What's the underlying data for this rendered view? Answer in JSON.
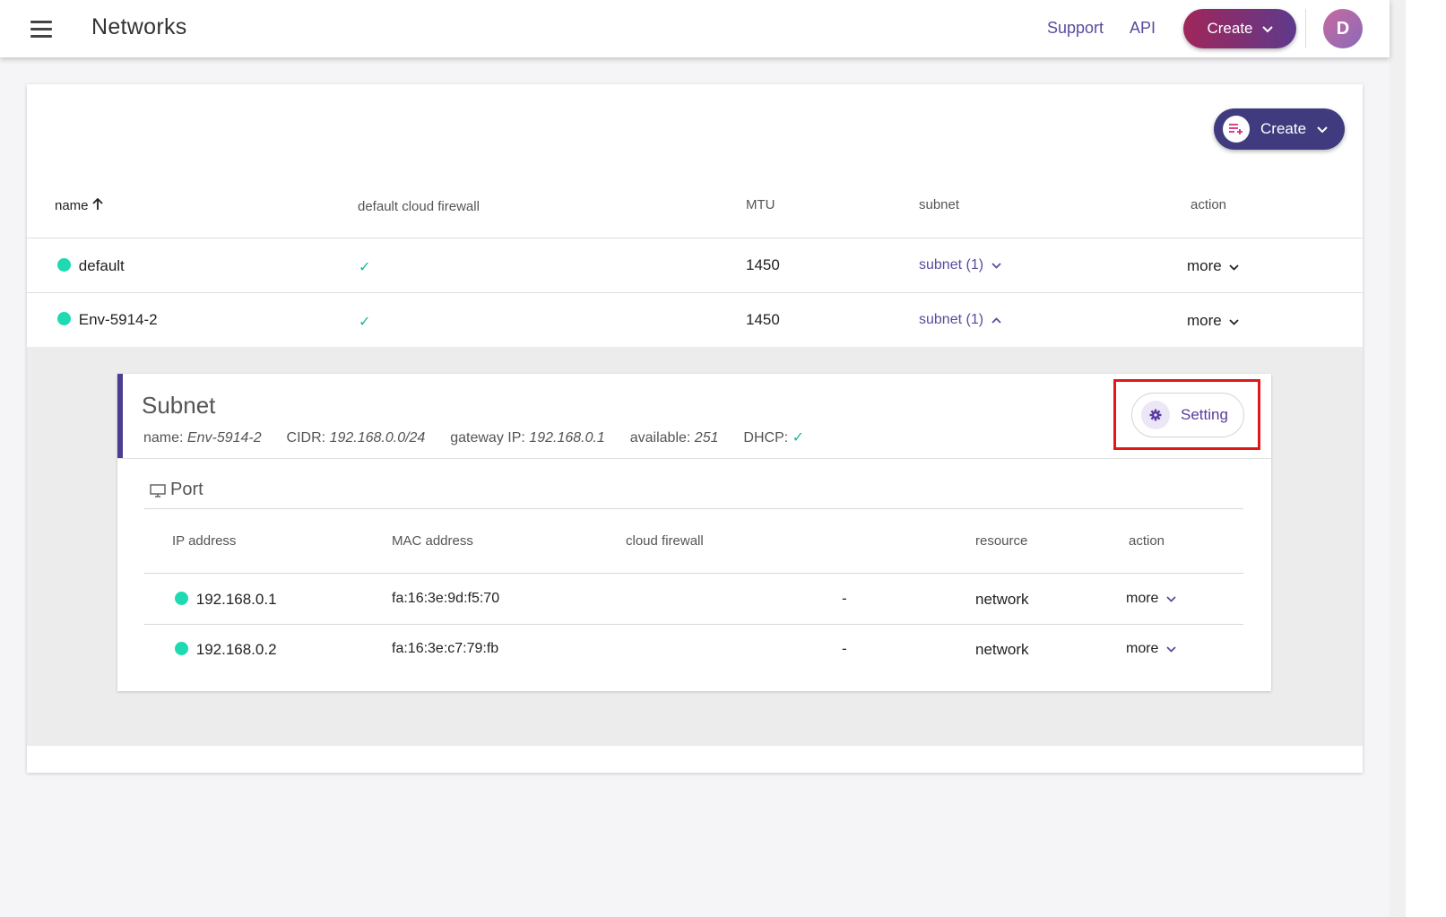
{
  "header": {
    "title": "Networks",
    "links": [
      "Support",
      "API"
    ],
    "create_label": "Create",
    "avatar_initial": "D"
  },
  "toolbar": {
    "create_label": "Create"
  },
  "table": {
    "columns": [
      "name",
      "default cloud firewall",
      "MTU",
      "subnet",
      "action"
    ],
    "rows": [
      {
        "name": "default",
        "firewall": "✓",
        "mtu": "1450",
        "subnet": "subnet (1)",
        "subnet_state": "collapsed",
        "action": "more"
      },
      {
        "name": "Env-5914-2",
        "firewall": "✓",
        "mtu": "1450",
        "subnet": "subnet (1)",
        "subnet_state": "expanded",
        "action": "more"
      }
    ]
  },
  "subnet": {
    "title": "Subnet",
    "name_label": "name:",
    "name": "Env-5914-2",
    "cidr_label": "CIDR:",
    "cidr": "192.168.0.0/24",
    "gateway_label": "gateway IP:",
    "gateway": "192.168.0.1",
    "available_label": "available:",
    "available": "251",
    "dhcp_label": "DHCP:",
    "dhcp": "✓",
    "setting_label": "Setting"
  },
  "port": {
    "title": "Port",
    "columns": [
      "IP address",
      "MAC address",
      "cloud firewall",
      "resource",
      "action"
    ],
    "rows": [
      {
        "ip": "192.168.0.1",
        "mac": "fa:16:3e:9d:f5:70",
        "firewall": "-",
        "resource": "network",
        "resource_link": true,
        "action": "more"
      },
      {
        "ip": "192.168.0.2",
        "mac": "fa:16:3e:c7:79:fb",
        "firewall": "-",
        "resource": "network",
        "resource_link": false,
        "action": "more"
      }
    ]
  },
  "colors": {
    "accent": "#4b3d8f",
    "status_green": "#1ddab0",
    "link": "#5b4a9e",
    "highlight": "#e01818"
  }
}
